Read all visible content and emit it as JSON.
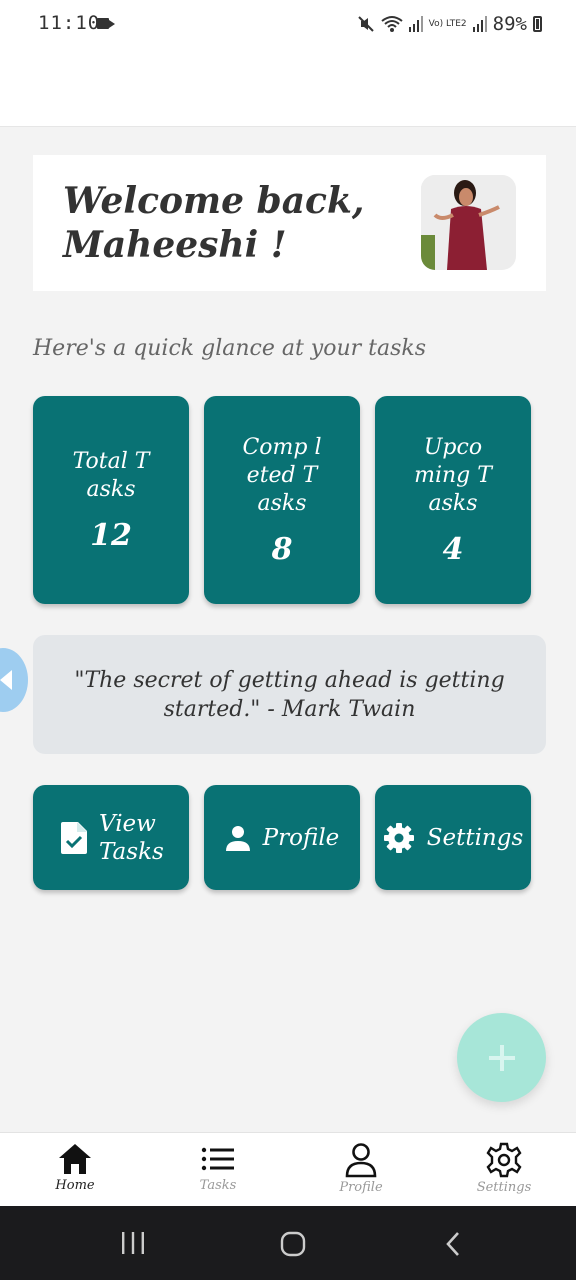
{
  "status_bar": {
    "time": "11:10",
    "network": "Vo) LTE2",
    "battery": "89%"
  },
  "welcome": {
    "line1": "Welcome back,",
    "line2": "Maheeshi !"
  },
  "subtitle": "Here's a quick glance at your tasks",
  "stats": [
    {
      "label": "Total Tasks",
      "value": "12"
    },
    {
      "label": "Comp leted Tasks",
      "value": "8"
    },
    {
      "label": "Upco ming Tasks",
      "value": "4"
    }
  ],
  "quote": "\"The secret of getting ahead is getting started.\" - Mark Twain",
  "actions": [
    {
      "label": "View Tasks",
      "icon": "task-file-icon"
    },
    {
      "label": "Profile",
      "icon": "person-icon"
    },
    {
      "label": "Settings",
      "icon": "gear-icon"
    }
  ],
  "fab_icon": "plus-icon",
  "bottom_nav": [
    {
      "label": "Home",
      "icon": "home-icon",
      "active": true
    },
    {
      "label": "Tasks",
      "icon": "list-icon",
      "active": false
    },
    {
      "label": "Profile",
      "icon": "person-outline-icon",
      "active": false
    },
    {
      "label": "Settings",
      "icon": "gear-outline-icon",
      "active": false
    }
  ],
  "colors": {
    "primary": "#097274",
    "fab": "#a7e6d8",
    "quote_bg": "#e3e6e9"
  }
}
